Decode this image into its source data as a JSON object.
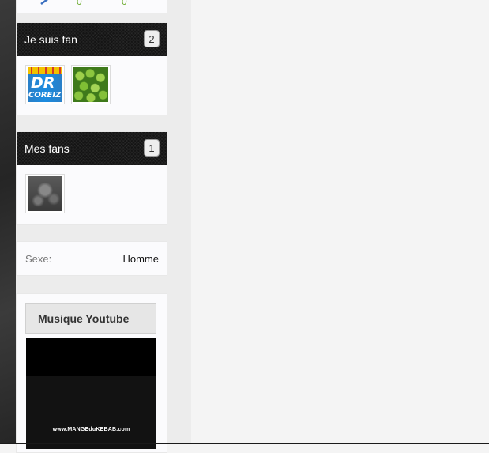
{
  "stats": {
    "value_a": "0",
    "value_b": "0"
  },
  "fan_of": {
    "title": "Je suis fan",
    "count": "2",
    "thumb1": {
      "line1": "DR",
      "line2": "COREIZ"
    }
  },
  "my_fans": {
    "title": "Mes fans",
    "count": "1"
  },
  "profile": {
    "sex_label": "Sexe:",
    "sex_value": "Homme"
  },
  "music": {
    "title": "Musique Youtube",
    "video_watermark": "www.MANGEduKEBAB.com"
  },
  "colors": {
    "stat_green": "#6aaa2b",
    "header_dark": "#141414"
  }
}
